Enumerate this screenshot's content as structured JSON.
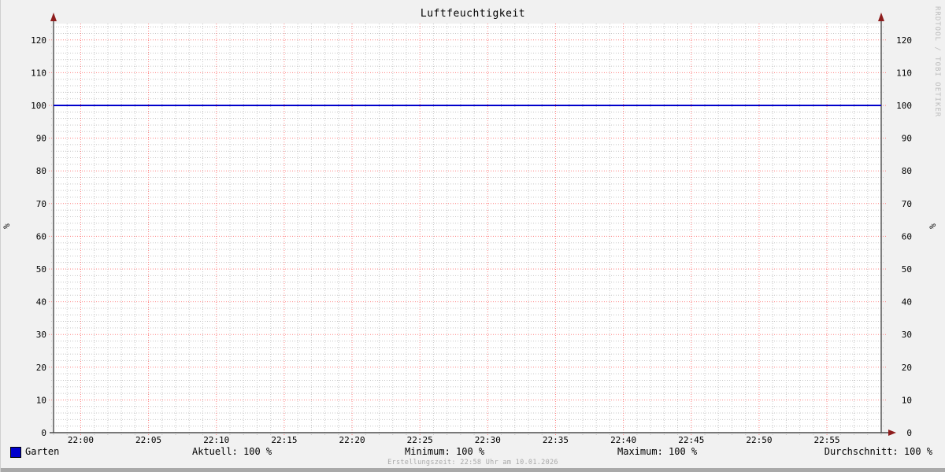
{
  "window": {
    "background": "#f1f1f1",
    "plot_background": "#ffffff",
    "bottom_bar_color": "#a9a9a9"
  },
  "title": "Luftfeuchtigkeit",
  "watermark": "RRDTOOL / TOBI OETIKER",
  "axis_unit_left": "%",
  "axis_unit_right": "%",
  "chart_data": {
    "type": "line",
    "title": "Luftfeuchtigkeit",
    "ylabel": "%",
    "ylim": [
      0,
      125
    ],
    "y_ticks": [
      0,
      10,
      20,
      30,
      40,
      50,
      60,
      70,
      80,
      90,
      100,
      110,
      120
    ],
    "y_minor_step": 2,
    "x_minutes_range": [
      -2,
      59
    ],
    "x_minor_step": 1,
    "x_ticks": [
      {
        "minute": 0,
        "label": "22:00"
      },
      {
        "minute": 5,
        "label": "22:05"
      },
      {
        "minute": 10,
        "label": "22:10"
      },
      {
        "minute": 15,
        "label": "22:15"
      },
      {
        "minute": 20,
        "label": "22:20"
      },
      {
        "minute": 25,
        "label": "22:25"
      },
      {
        "minute": 30,
        "label": "22:30"
      },
      {
        "minute": 35,
        "label": "22:35"
      },
      {
        "minute": 40,
        "label": "22:40"
      },
      {
        "minute": 45,
        "label": "22:45"
      },
      {
        "minute": 50,
        "label": "22:50"
      },
      {
        "minute": 55,
        "label": "22:55"
      }
    ],
    "grid": {
      "minor_color": "#c6c6c6",
      "major_color": "#ff8080"
    },
    "axis_color": "#4d4d4d",
    "arrow_color": "#8e1d1d",
    "series": [
      {
        "name": "Garten",
        "color": "#0000cc",
        "points": [
          [
            -2,
            100
          ],
          [
            59,
            100
          ]
        ]
      }
    ],
    "stats": {
      "aktuell": 100,
      "minimum": 100,
      "maximum": 100,
      "durchschnitt": 100,
      "unit": "%"
    },
    "legend_position": "bottom"
  },
  "legend": {
    "series_label": "Garten",
    "aktuell": "Aktuell: 100 %",
    "minimum": "Minimum: 100 %",
    "maximum": "Maximum: 100 %",
    "durchschnitt": "Durchschnitt: 100 %"
  },
  "footer": {
    "creation_line": "Erstellungszeit: 22:58 Uhr am 10.01.2026"
  }
}
